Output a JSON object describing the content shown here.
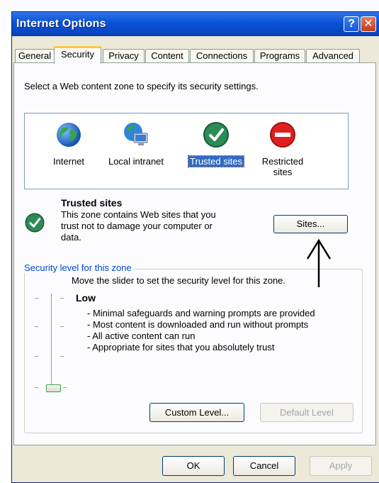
{
  "window": {
    "title": "Internet Options",
    "help_glyph": "?",
    "close_glyph": "✕"
  },
  "tabs": [
    {
      "label": "General"
    },
    {
      "label": "Security"
    },
    {
      "label": "Privacy"
    },
    {
      "label": "Content"
    },
    {
      "label": "Connections"
    },
    {
      "label": "Programs"
    },
    {
      "label": "Advanced"
    }
  ],
  "active_tab": "Security",
  "zone_prompt": "Select a Web content zone to specify its security settings.",
  "zones": [
    {
      "label": "Internet",
      "icon": "globe-icon"
    },
    {
      "label": "Local intranet",
      "icon": "intranet-icon"
    },
    {
      "label": "Trusted sites",
      "icon": "checkmark-icon",
      "selected": true
    },
    {
      "label_line1": "Restricted",
      "label_line2": "sites",
      "icon": "no-entry-icon"
    }
  ],
  "zone_info": {
    "title": "Trusted sites",
    "line1": "This zone contains Web sites that you",
    "line2": "trust not to damage your computer or",
    "line3": "data.",
    "sites_button": "Sites..."
  },
  "security_level": {
    "group_title": "Security level for this zone",
    "instruction": "Move the slider to set the security level for this zone.",
    "level_name": "Low",
    "bullets": [
      "- Minimal safeguards and warning prompts are provided",
      "- Most content is downloaded and run without prompts",
      "- All active content can run",
      "- Appropriate for sites that you absolutely trust"
    ],
    "custom_button": "Custom Level...",
    "default_button": "Default Level",
    "slider_level_fraction": 0.0
  },
  "footer": {
    "ok": "OK",
    "cancel": "Cancel",
    "apply": "Apply"
  },
  "colors": {
    "titlebar": "#0a52d6",
    "selection": "#316ac5",
    "group_title": "#0046d5",
    "tab_highlight": "#ffc83c"
  }
}
